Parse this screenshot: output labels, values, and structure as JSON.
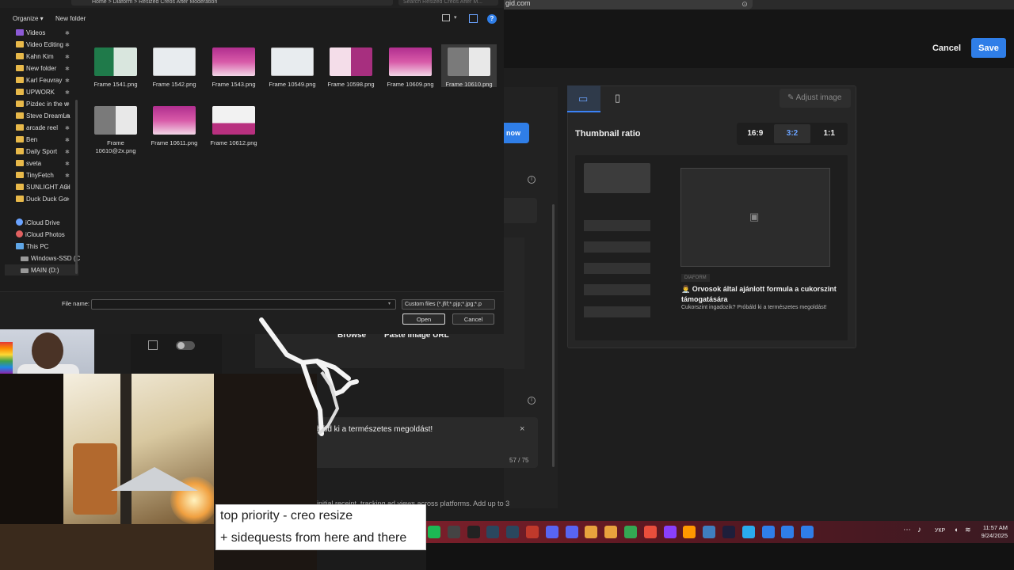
{
  "browser": {
    "address_tail": "gid.com"
  },
  "editor": {
    "cancel_label": "Cancel",
    "save_label": "Save",
    "now_label": "now",
    "browse_label": "Browse",
    "paste_url_label": "Paste image URL",
    "description_text": "báld ki a természetes megoldást!",
    "description_count": "57 / 75",
    "bottom_text": "initial receipt, tracking ad views across platforms. Add up to 3",
    "info_glyph": "i",
    "close_glyph": "×"
  },
  "preview": {
    "adjust_image_label": "Adjust image",
    "thumbnail_ratio_label": "Thumbnail ratio",
    "ratios": [
      "16:9",
      "3:2",
      "1:1"
    ],
    "active_ratio": "3:2",
    "brand": "DIAFORM",
    "title": "👨‍⚕️ Orvosok által ajánlott formula a cukorszint támogatására",
    "subtitle": "Cukorszint ingadozik? Próbáld ki a természetes megoldást!",
    "icons": {
      "desktop": "desktop-icon",
      "mobile": "mobile-icon",
      "pencil": "pencil-icon",
      "image": "image-icon"
    }
  },
  "dialog": {
    "path_text": "Home > Diaform > Resized Creos After Moderation",
    "search_placeholder": "Search Resized Creos After M...",
    "organize_label": "Organize ▾",
    "new_folder_label": "New folder",
    "help_glyph": "?",
    "view_caret": "▾",
    "nav_items": [
      {
        "label": "Videos",
        "icon": "purple",
        "pinned": true
      },
      {
        "label": "Video Editing",
        "icon": "folder",
        "pinned": true
      },
      {
        "label": "Kahn Kim",
        "icon": "folder",
        "pinned": true
      },
      {
        "label": "New folder",
        "icon": "folder",
        "pinned": true
      },
      {
        "label": "Karl Feuvray",
        "icon": "folder",
        "pinned": true
      },
      {
        "label": "UPWORK",
        "icon": "folder",
        "pinned": true
      },
      {
        "label": "Pizdec in the w",
        "icon": "folder",
        "pinned": true
      },
      {
        "label": "Steve DreamLa",
        "icon": "folder",
        "pinned": true
      },
      {
        "label": "arcade reel",
        "icon": "folder",
        "pinned": true
      },
      {
        "label": "Ben",
        "icon": "folder",
        "pinned": true
      },
      {
        "label": "Daily Sport",
        "icon": "folder",
        "pinned": true
      },
      {
        "label": "sveta",
        "icon": "folder",
        "pinned": true
      },
      {
        "label": "TinyFetch",
        "icon": "folder",
        "pinned": true
      },
      {
        "label": "SUNLIGHT AGI",
        "icon": "folder",
        "pinned": true
      },
      {
        "label": "Duck Duck Go",
        "icon": "folder",
        "pinned": true
      },
      {
        "label": "iCloud Drive",
        "icon": "cloud",
        "pinned": false
      },
      {
        "label": "iCloud Photos",
        "icon": "photos",
        "pinned": false
      },
      {
        "label": "This PC",
        "icon": "pc",
        "pinned": false
      },
      {
        "label": "Windows-SSD (C",
        "icon": "drive",
        "pinned": false
      },
      {
        "label": "MAIN (D:)",
        "icon": "drive",
        "pinned": false
      }
    ],
    "pin_glyph": "📌",
    "files": [
      {
        "name": "Frame 1541.png",
        "thumb": "t-green"
      },
      {
        "name": "Frame 1542.png",
        "thumb": "t-white"
      },
      {
        "name": "Frame 1543.png",
        "thumb": "t-pink"
      },
      {
        "name": "Frame 10549.png",
        "thumb": "t-white"
      },
      {
        "name": "Frame 10598.png",
        "thumb": "t-pink2"
      },
      {
        "name": "Frame 10609.png",
        "thumb": "t-pink"
      },
      {
        "name": "Frame 10610.png",
        "thumb": "t-grey"
      },
      {
        "name": "Frame 10610@2x.png",
        "thumb": "t-grey"
      },
      {
        "name": "Frame 10611.png",
        "thumb": "t-pink"
      },
      {
        "name": "Frame 10612.png",
        "thumb": "t-whitepink"
      }
    ],
    "selected_file": "Frame 10610.png",
    "file_name_label": "File name:",
    "file_name_value": "",
    "file_type": "Custom files (*.jfif;*.pjp;*.jpg;*.p",
    "open_label": "Open",
    "cancel_label": "Cancel"
  },
  "stream": {
    "caption_line1": "top priority - creo resize",
    "caption_line2": "+ sidequests from here and there"
  },
  "taskbar": {
    "language": "УКР",
    "time": "11:57 AM",
    "date": "9/24/2025",
    "more_glyph": "⋯",
    "apps": [
      "spotify-icon",
      "notes-icon",
      "steam-icon",
      "steam-icon",
      "steam-icon",
      "opera-icon",
      "discord-icon",
      "discord-icon",
      "chrome-icon",
      "chrome-icon",
      "chrome-icon",
      "figma-icon",
      "messenger-icon",
      "sublime-icon",
      "notepad-icon",
      "terminal-icon",
      "telegram-icon",
      "tool-icon",
      "tool-icon",
      "tool-icon"
    ]
  }
}
